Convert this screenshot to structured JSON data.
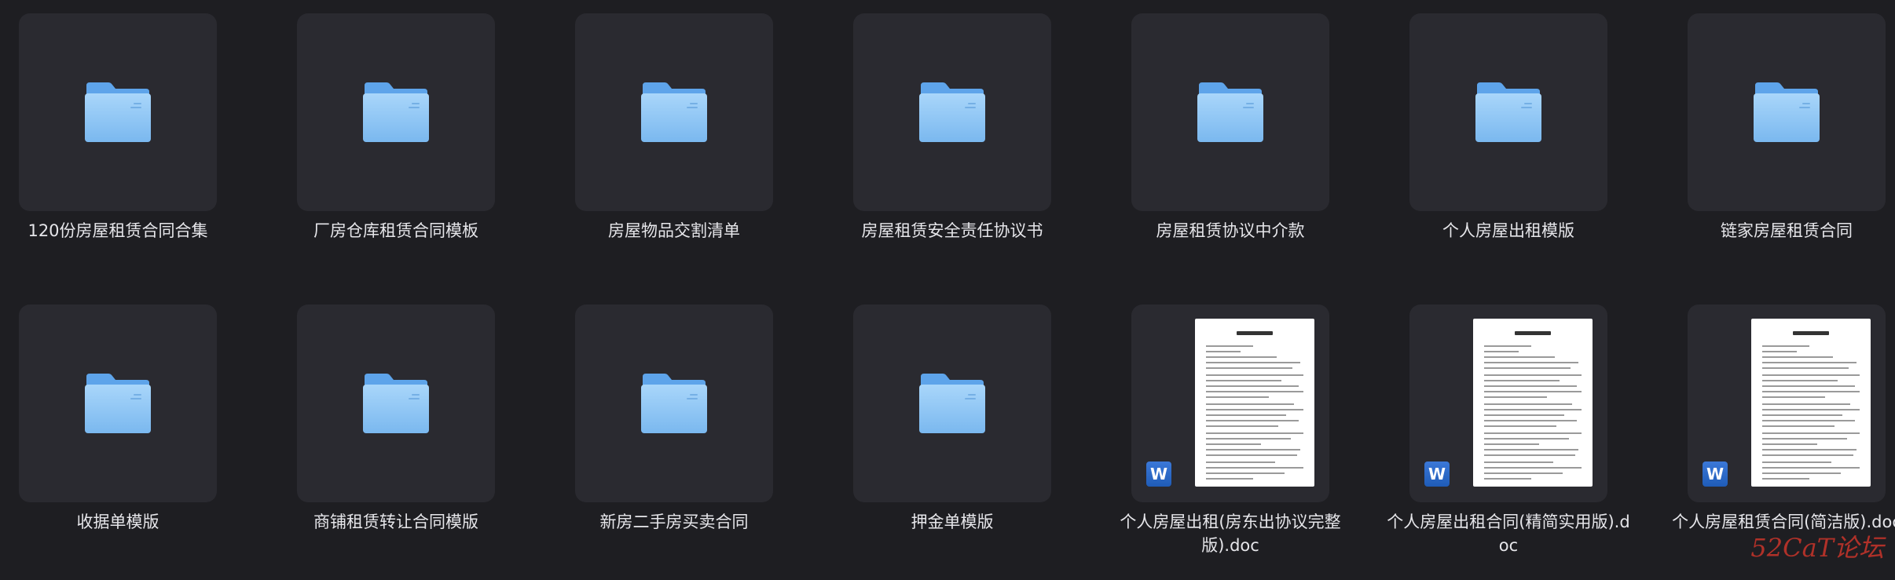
{
  "items": [
    {
      "type": "folder",
      "name": "120份房屋租赁合同合集"
    },
    {
      "type": "folder",
      "name": "厂房仓库租赁合同模板"
    },
    {
      "type": "folder",
      "name": "房屋物品交割清单"
    },
    {
      "type": "folder",
      "name": "房屋租赁安全责任协议书"
    },
    {
      "type": "folder",
      "name": "房屋租赁协议中介款"
    },
    {
      "type": "folder",
      "name": "个人房屋出租模版"
    },
    {
      "type": "folder",
      "name": "链家房屋租赁合同"
    },
    {
      "type": "folder",
      "name": "收据单模版"
    },
    {
      "type": "folder",
      "name": "商铺租赁转让合同模版"
    },
    {
      "type": "folder",
      "name": "新房二手房买卖合同"
    },
    {
      "type": "folder",
      "name": "押金单模版"
    },
    {
      "type": "doc",
      "name": "个人房屋出租(房东出协议完整版).doc",
      "icon": "word-icon",
      "badge": "W"
    },
    {
      "type": "doc",
      "name": "个人房屋出租合同(精简实用版).doc",
      "icon": "word-icon",
      "badge": "W"
    },
    {
      "type": "doc",
      "name": "个人房屋租赁合同(简洁版).doc",
      "icon": "word-icon",
      "badge": "W"
    }
  ],
  "watermark": "52CaT论坛",
  "colors": {
    "background": "#1e1e22",
    "tile": "#2a2a30",
    "folder_front": "#8cc4f3",
    "folder_back": "#5ea4ea",
    "word_blue": "#2b6bd0",
    "watermark": "#c0342a"
  }
}
